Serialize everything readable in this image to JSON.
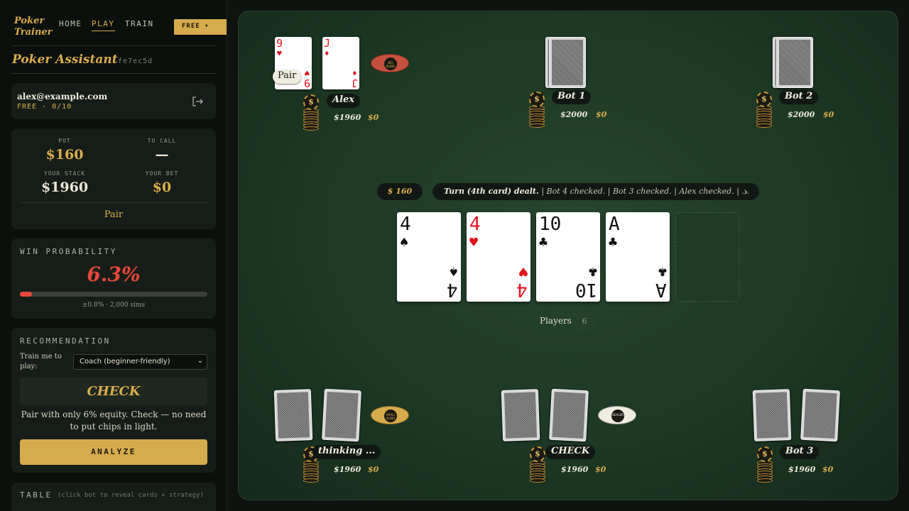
{
  "app": {
    "logo_line1": "Poker",
    "logo_line2": "Trainer",
    "nav": [
      "HOME",
      "PLAY",
      "TRAIN"
    ],
    "plan_button": "FREE ▾"
  },
  "assistant": {
    "title": "Poker Assistant",
    "session_id": "fe7ec5d"
  },
  "account": {
    "email": "alex@example.com",
    "plan": "FREE · 0/10"
  },
  "stats": {
    "pot_label": "POT",
    "pot": "$160",
    "to_call_label": "TO CALL",
    "to_call": "—",
    "stack_label": "YOUR STACK",
    "stack": "$1960",
    "bet_label": "YOUR BET",
    "bet": "$0",
    "hand": "Pair"
  },
  "win": {
    "label": "WIN PROBABILITY",
    "value": "6.3%",
    "fraction": 0.063,
    "detail": "±0.8% · 2,000 sims"
  },
  "recommendation": {
    "label": "RECOMMENDATION",
    "train_label": "Train me to play:",
    "mode": "Coach (beginner-friendly)",
    "action": "CHECK",
    "explanation": "Pair with only 6% equity. Check — no need to put chips in light.",
    "analyze_button": "ANALYZE"
  },
  "table_section": {
    "label": "TABLE",
    "hint": "(click bot to reveal cards + strategy)"
  },
  "table": {
    "pot_badge": "$ 160",
    "log": "Turn (4th card) dealt.",
    "log_rest": " | Bot 4 checked. | Bot 3 checked. | Alex checked. | ...",
    "players_label": "Players",
    "players_count": "6",
    "community": [
      {
        "rank": "4",
        "suit": "♠",
        "color": "black"
      },
      {
        "rank": "4",
        "suit": "♥",
        "color": "red"
      },
      {
        "rank": "10",
        "suit": "♣",
        "color": "black"
      },
      {
        "rank": "A",
        "suit": "♣",
        "color": "black"
      }
    ]
  },
  "seats": {
    "alex": {
      "name": "Alex",
      "stack": "$1960",
      "bet": "$0",
      "hand_label": "Pair",
      "cards": [
        {
          "rank": "9",
          "suit": "♥"
        },
        {
          "rank": "J",
          "suit": "♦"
        }
      ],
      "puck": "BIG BLIND"
    },
    "bot1": {
      "name": "Bot 1",
      "stack": "$2000",
      "bet": "$0"
    },
    "bot2": {
      "name": "Bot 2",
      "stack": "$2000",
      "bet": "$0"
    },
    "bot_sb": {
      "name": "thinking ...",
      "stack": "$1960",
      "bet": "$0",
      "puck": "SMALL BLIND"
    },
    "bot_dealer": {
      "name": "CHECK",
      "stack": "$1960",
      "bet": "$0",
      "puck": "DEALER"
    },
    "bot3": {
      "name": "Bot 3",
      "stack": "$1960",
      "bet": "$0"
    }
  },
  "colors": {
    "accent": "#d9ac4c",
    "danger": "#e5463a",
    "felt": "#1d3824"
  }
}
